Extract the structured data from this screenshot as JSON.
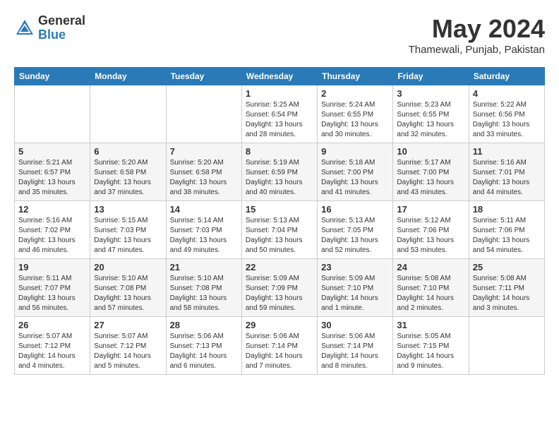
{
  "header": {
    "logo_general": "General",
    "logo_blue": "Blue",
    "month": "May 2024",
    "location": "Thamewali, Punjab, Pakistan"
  },
  "days_of_week": [
    "Sunday",
    "Monday",
    "Tuesday",
    "Wednesday",
    "Thursday",
    "Friday",
    "Saturday"
  ],
  "weeks": [
    [
      {
        "day": "",
        "info": ""
      },
      {
        "day": "",
        "info": ""
      },
      {
        "day": "",
        "info": ""
      },
      {
        "day": "1",
        "info": "Sunrise: 5:25 AM\nSunset: 6:54 PM\nDaylight: 13 hours\nand 28 minutes."
      },
      {
        "day": "2",
        "info": "Sunrise: 5:24 AM\nSunset: 6:55 PM\nDaylight: 13 hours\nand 30 minutes."
      },
      {
        "day": "3",
        "info": "Sunrise: 5:23 AM\nSunset: 6:55 PM\nDaylight: 13 hours\nand 32 minutes."
      },
      {
        "day": "4",
        "info": "Sunrise: 5:22 AM\nSunset: 6:56 PM\nDaylight: 13 hours\nand 33 minutes."
      }
    ],
    [
      {
        "day": "5",
        "info": "Sunrise: 5:21 AM\nSunset: 6:57 PM\nDaylight: 13 hours\nand 35 minutes."
      },
      {
        "day": "6",
        "info": "Sunrise: 5:20 AM\nSunset: 6:58 PM\nDaylight: 13 hours\nand 37 minutes."
      },
      {
        "day": "7",
        "info": "Sunrise: 5:20 AM\nSunset: 6:58 PM\nDaylight: 13 hours\nand 38 minutes."
      },
      {
        "day": "8",
        "info": "Sunrise: 5:19 AM\nSunset: 6:59 PM\nDaylight: 13 hours\nand 40 minutes."
      },
      {
        "day": "9",
        "info": "Sunrise: 5:18 AM\nSunset: 7:00 PM\nDaylight: 13 hours\nand 41 minutes."
      },
      {
        "day": "10",
        "info": "Sunrise: 5:17 AM\nSunset: 7:00 PM\nDaylight: 13 hours\nand 43 minutes."
      },
      {
        "day": "11",
        "info": "Sunrise: 5:16 AM\nSunset: 7:01 PM\nDaylight: 13 hours\nand 44 minutes."
      }
    ],
    [
      {
        "day": "12",
        "info": "Sunrise: 5:16 AM\nSunset: 7:02 PM\nDaylight: 13 hours\nand 46 minutes."
      },
      {
        "day": "13",
        "info": "Sunrise: 5:15 AM\nSunset: 7:03 PM\nDaylight: 13 hours\nand 47 minutes."
      },
      {
        "day": "14",
        "info": "Sunrise: 5:14 AM\nSunset: 7:03 PM\nDaylight: 13 hours\nand 49 minutes."
      },
      {
        "day": "15",
        "info": "Sunrise: 5:13 AM\nSunset: 7:04 PM\nDaylight: 13 hours\nand 50 minutes."
      },
      {
        "day": "16",
        "info": "Sunrise: 5:13 AM\nSunset: 7:05 PM\nDaylight: 13 hours\nand 52 minutes."
      },
      {
        "day": "17",
        "info": "Sunrise: 5:12 AM\nSunset: 7:06 PM\nDaylight: 13 hours\nand 53 minutes."
      },
      {
        "day": "18",
        "info": "Sunrise: 5:11 AM\nSunset: 7:06 PM\nDaylight: 13 hours\nand 54 minutes."
      }
    ],
    [
      {
        "day": "19",
        "info": "Sunrise: 5:11 AM\nSunset: 7:07 PM\nDaylight: 13 hours\nand 56 minutes."
      },
      {
        "day": "20",
        "info": "Sunrise: 5:10 AM\nSunset: 7:08 PM\nDaylight: 13 hours\nand 57 minutes."
      },
      {
        "day": "21",
        "info": "Sunrise: 5:10 AM\nSunset: 7:08 PM\nDaylight: 13 hours\nand 58 minutes."
      },
      {
        "day": "22",
        "info": "Sunrise: 5:09 AM\nSunset: 7:09 PM\nDaylight: 13 hours\nand 59 minutes."
      },
      {
        "day": "23",
        "info": "Sunrise: 5:09 AM\nSunset: 7:10 PM\nDaylight: 14 hours\nand 1 minute."
      },
      {
        "day": "24",
        "info": "Sunrise: 5:08 AM\nSunset: 7:10 PM\nDaylight: 14 hours\nand 2 minutes."
      },
      {
        "day": "25",
        "info": "Sunrise: 5:08 AM\nSunset: 7:11 PM\nDaylight: 14 hours\nand 3 minutes."
      }
    ],
    [
      {
        "day": "26",
        "info": "Sunrise: 5:07 AM\nSunset: 7:12 PM\nDaylight: 14 hours\nand 4 minutes."
      },
      {
        "day": "27",
        "info": "Sunrise: 5:07 AM\nSunset: 7:12 PM\nDaylight: 14 hours\nand 5 minutes."
      },
      {
        "day": "28",
        "info": "Sunrise: 5:06 AM\nSunset: 7:13 PM\nDaylight: 14 hours\nand 6 minutes."
      },
      {
        "day": "29",
        "info": "Sunrise: 5:06 AM\nSunset: 7:14 PM\nDaylight: 14 hours\nand 7 minutes."
      },
      {
        "day": "30",
        "info": "Sunrise: 5:06 AM\nSunset: 7:14 PM\nDaylight: 14 hours\nand 8 minutes."
      },
      {
        "day": "31",
        "info": "Sunrise: 5:05 AM\nSunset: 7:15 PM\nDaylight: 14 hours\nand 9 minutes."
      },
      {
        "day": "",
        "info": ""
      }
    ]
  ]
}
